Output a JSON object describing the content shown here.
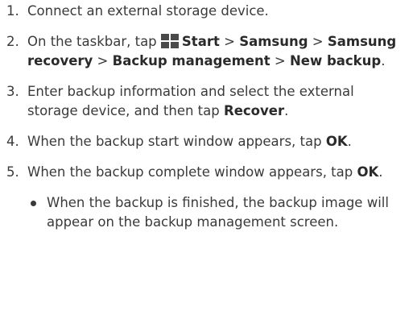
{
  "steps": [
    {
      "num": "1.",
      "text": "Connect an external storage device."
    },
    {
      "num": "2.",
      "prefix": "On the taskbar, tap",
      "icon": "windows-start-icon",
      "path_start": "Start",
      "sep1": " > ",
      "path_samsung": "Samsung",
      "sep2": " > ",
      "path_recovery": "Samsung recovery",
      "sep3": " > ",
      "path_backup_mgmt": "Backup management",
      "sep4": " > ",
      "path_new_backup": "New backup",
      "suffix": "."
    },
    {
      "num": "3.",
      "text": "Enter backup information and select the external storage device, and then tap ",
      "bold": "Recover",
      "suffix": "."
    },
    {
      "num": "4.",
      "text": "When the backup start window appears, tap ",
      "bold": "OK",
      "suffix": "."
    },
    {
      "num": "5.",
      "text": "When the backup complete window appears, tap ",
      "bold": "OK",
      "suffix": "."
    }
  ],
  "bullets": [
    "When the backup is finished, the backup image will appear on the backup management screen."
  ],
  "colors": {
    "text": "#3a3a3a",
    "icon": "#4a4a4a"
  }
}
